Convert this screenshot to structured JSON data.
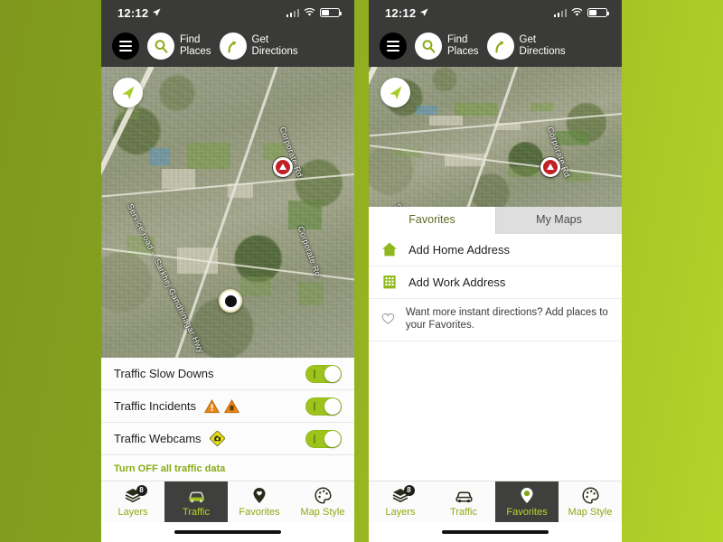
{
  "background": {
    "accent_green": "#9dc41c",
    "gradient_from": "#7f981d",
    "gradient_to": "#b5d32a"
  },
  "status_bar": {
    "time": "12:12",
    "location_icon": "location-arrow-icon",
    "signal_icon": "cellular-signal-icon",
    "wifi_icon": "wifi-icon",
    "battery_icon": "battery-icon"
  },
  "app_header": {
    "menu_icon": "hamburger-menu-icon",
    "actions": [
      {
        "icon": "search-magnifier-icon",
        "label_line1": "Find",
        "label_line2": "Places"
      },
      {
        "icon": "turn-right-arrow-icon",
        "label_line1": "Get",
        "label_line2": "Directions"
      }
    ]
  },
  "map": {
    "locate_icon": "navigation-arrow-icon",
    "road_labels": [
      "Service road -- Sarkhej Gandhinagar Hwy",
      "Corporate Rd",
      "Corporate Rd"
    ],
    "markers": [
      {
        "name": "incident-marker",
        "type": "red-alert-pin"
      },
      {
        "name": "location-marker",
        "type": "white-black-dot"
      }
    ]
  },
  "traffic_panel": {
    "rows": [
      {
        "label": "Traffic Slow Downs",
        "toggle": "on",
        "icons": []
      },
      {
        "label": "Traffic Incidents",
        "toggle": "on",
        "icons": [
          "warning-triangle-icon",
          "roadwork-triangle-icon"
        ]
      },
      {
        "label": "Traffic Webcams",
        "toggle": "on",
        "icons": [
          "webcam-diamond-icon"
        ]
      }
    ],
    "turn_off_link": "Turn OFF all traffic data"
  },
  "favorites_panel": {
    "tabs": [
      {
        "label": "Favorites",
        "active": true
      },
      {
        "label": "My Maps",
        "active": false
      }
    ],
    "rows": [
      {
        "icon": "home-icon",
        "label": "Add Home Address"
      },
      {
        "icon": "office-building-icon",
        "label": "Add Work Address"
      }
    ],
    "note": {
      "icon": "heart-outline-icon",
      "text": "Want more instant directions? Add places to your Favorites."
    }
  },
  "tab_bar_left": {
    "tabs": [
      {
        "label": "Layers",
        "icon": "layers-icon",
        "badge": "8",
        "active": false
      },
      {
        "label": "Traffic",
        "icon": "car-icon",
        "badge": "",
        "active": true
      },
      {
        "label": "Favorites",
        "icon": "map-pin-heart-icon",
        "badge": "",
        "active": false
      },
      {
        "label": "Map Style",
        "icon": "palette-icon",
        "badge": "",
        "active": false
      }
    ]
  },
  "tab_bar_right": {
    "tabs": [
      {
        "label": "Layers",
        "icon": "layers-icon",
        "badge": "8",
        "active": false
      },
      {
        "label": "Traffic",
        "icon": "car-icon",
        "badge": "",
        "active": false
      },
      {
        "label": "Favorites",
        "icon": "map-pin-heart-icon",
        "badge": "",
        "active": true
      },
      {
        "label": "Map Style",
        "icon": "palette-icon",
        "badge": "",
        "active": false
      }
    ]
  }
}
